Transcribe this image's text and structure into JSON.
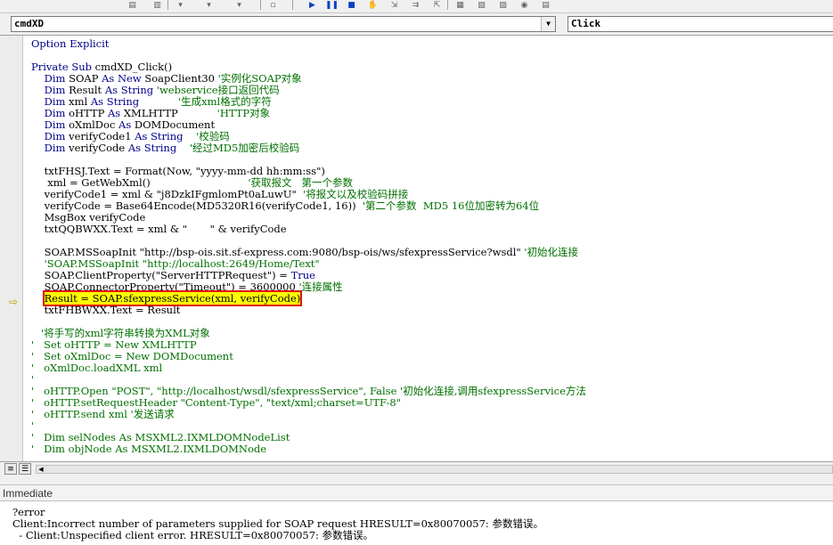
{
  "toolbar": {
    "icons": [
      "indent-icon",
      "outdent-icon",
      "list-properties-icon",
      "list-constants-icon",
      "quick-info-icon",
      "parameter-info-icon",
      "complete-word-icon",
      "toggle-breakpoint-icon",
      "comment-block-icon",
      "uncomment-block-icon",
      "toggle-bookmark-icon",
      "next-bookmark-icon",
      "prev-bookmark-icon",
      "clear-bookmarks-icon"
    ]
  },
  "object_combo": {
    "value": "cmdXD"
  },
  "procedure_combo": {
    "value": "Click"
  },
  "code_lines": [
    [
      {
        "t": "kw",
        "v": "Option Explicit"
      }
    ],
    [
      {
        "t": "tx",
        "v": ""
      }
    ],
    [
      {
        "t": "kw",
        "v": "Private Sub "
      },
      {
        "t": "tx",
        "v": "cmdXD_Click()"
      }
    ],
    [
      {
        "t": "kw",
        "v": "    Dim "
      },
      {
        "t": "tx",
        "v": "SOAP "
      },
      {
        "t": "kw",
        "v": "As New "
      },
      {
        "t": "tx",
        "v": "SoapClient30 "
      },
      {
        "t": "cm",
        "v": "'实例化SOAP对象"
      }
    ],
    [
      {
        "t": "kw",
        "v": "    Dim "
      },
      {
        "t": "tx",
        "v": "Result "
      },
      {
        "t": "kw",
        "v": "As String "
      },
      {
        "t": "cm",
        "v": "'webservice接口返回代码"
      }
    ],
    [
      {
        "t": "kw",
        "v": "    Dim "
      },
      {
        "t": "tx",
        "v": "xml "
      },
      {
        "t": "kw",
        "v": "As String            "
      },
      {
        "t": "cm",
        "v": "'生成xml格式的字符"
      }
    ],
    [
      {
        "t": "kw",
        "v": "    Dim "
      },
      {
        "t": "tx",
        "v": "oHTTP "
      },
      {
        "t": "kw",
        "v": "As "
      },
      {
        "t": "tx",
        "v": "XMLHTTP            "
      },
      {
        "t": "cm",
        "v": "'HTTP对象"
      }
    ],
    [
      {
        "t": "kw",
        "v": "    Dim "
      },
      {
        "t": "tx",
        "v": "oXmlDoc "
      },
      {
        "t": "kw",
        "v": "As "
      },
      {
        "t": "tx",
        "v": "DOMDocument"
      }
    ],
    [
      {
        "t": "kw",
        "v": "    Dim "
      },
      {
        "t": "tx",
        "v": "verifyCode1 "
      },
      {
        "t": "kw",
        "v": "As String    "
      },
      {
        "t": "cm",
        "v": "'校验码"
      }
    ],
    [
      {
        "t": "kw",
        "v": "    Dim "
      },
      {
        "t": "tx",
        "v": "verifyCode "
      },
      {
        "t": "kw",
        "v": "As String    "
      },
      {
        "t": "cm",
        "v": "'经过MD5加密后校验码"
      }
    ],
    [
      {
        "t": "tx",
        "v": ""
      }
    ],
    [
      {
        "t": "tx",
        "v": "    txtFHSJ.Text = Format(Now, \"yyyy-mm-dd hh:mm:ss\")"
      }
    ],
    [
      {
        "t": "tx",
        "v": "     xml = GetWebXml()                              "
      },
      {
        "t": "cm",
        "v": "'获取报文   第一个参数"
      }
    ],
    [
      {
        "t": "tx",
        "v": "    verifyCode1 = xml & \"j8DzkIFgmlomPt0aLuwU\"  "
      },
      {
        "t": "cm",
        "v": "'将报文以及校验码拼接"
      }
    ],
    [
      {
        "t": "tx",
        "v": "    verifyCode = Base64Encode(MD5320R16(verifyCode1, 16))  "
      },
      {
        "t": "cm",
        "v": "'第二个参数  MD5 16位加密转为64位"
      }
    ],
    [
      {
        "t": "tx",
        "v": "    MsgBox verifyCode"
      }
    ],
    [
      {
        "t": "tx",
        "v": "    txtQQBWXX.Text = xml & \"       \" & verifyCode"
      }
    ],
    [
      {
        "t": "tx",
        "v": ""
      }
    ],
    [
      {
        "t": "tx",
        "v": "    SOAP.MSSoapInit \"http://bsp-ois.sit.sf-express.com:9080/bsp-ois/ws/sfexpressService?wsdl\" "
      },
      {
        "t": "cm",
        "v": "'初始化连接"
      }
    ],
    [
      {
        "t": "cm",
        "v": "    'SOAP.MSSoapInit \"http://localhost:2649/Home/Text\""
      }
    ],
    [
      {
        "t": "tx",
        "v": "    SOAP.ClientProperty(\"ServerHTTPRequest\") = "
      },
      {
        "t": "kw",
        "v": "True"
      }
    ],
    [
      {
        "t": "tx",
        "v": "    SOAP.ConnectorProperty(\"Timeout\") = 3600000 "
      },
      {
        "t": "cm",
        "v": "'连接属性"
      }
    ],
    [
      {
        "t": "tx",
        "v": "    "
      },
      {
        "t": "hl",
        "v": "Result = SOAP.sfexpressService(xml, verifyCode)"
      }
    ],
    [
      {
        "t": "tx",
        "v": "    txtFHBWXX.Text = Result"
      }
    ],
    [
      {
        "t": "tx",
        "v": ""
      }
    ],
    [
      {
        "t": "cm",
        "v": "   '将手写的xml字符串转换为XML对象"
      }
    ],
    [
      {
        "t": "cm",
        "v": "'   Set oHTTP = New XMLHTTP"
      }
    ],
    [
      {
        "t": "cm",
        "v": "'   Set oXmlDoc = New DOMDocument"
      }
    ],
    [
      {
        "t": "cm",
        "v": "'   oXmlDoc.loadXML xml"
      }
    ],
    [
      {
        "t": "cm",
        "v": "'"
      }
    ],
    [
      {
        "t": "cm",
        "v": "'   oHTTP.Open \"POST\", \"http://localhost/wsdl/sfexpressService\", False '初始化连接,调用sfexpressService方法"
      }
    ],
    [
      {
        "t": "cm",
        "v": "'   oHTTP.setRequestHeader \"Content-Type\", \"text/xml;charset=UTF-8\""
      }
    ],
    [
      {
        "t": "cm",
        "v": "'   oHTTP.send xml '发送请求"
      }
    ],
    [
      {
        "t": "cm",
        "v": "'"
      }
    ],
    [
      {
        "t": "cm",
        "v": "'   Dim selNodes As MSXML2.IXMLDOMNodeList"
      }
    ],
    [
      {
        "t": "cm",
        "v": "'   Dim objNode As MSXML2.IXMLDOMNode"
      }
    ]
  ],
  "immediate": {
    "title": "Immediate",
    "lines": [
      "?error",
      "Client:Incorrect number of parameters supplied for SOAP request HRESULT=0x80070057: 参数错误。",
      "  - Client:Unspecified client error. HRESULT=0x80070057: 参数错误。"
    ]
  },
  "colors": {
    "keyword": "#00008b",
    "comment": "#007000",
    "highlight": "#ffff00",
    "highlight_border": "#e01010"
  }
}
